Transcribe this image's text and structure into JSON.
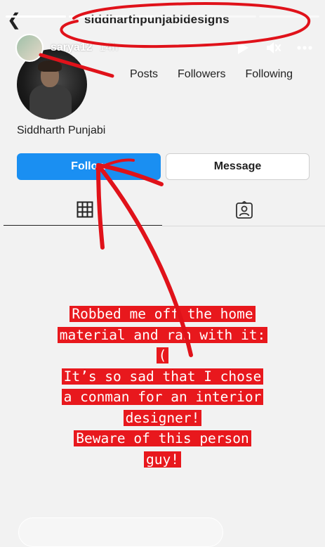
{
  "story": {
    "progress": [
      1,
      1,
      0.35,
      0,
      0
    ],
    "user": "sarya12",
    "time": "14h",
    "icons": {
      "play": "play-icon",
      "mute": "mute-icon",
      "more": "more-icon"
    }
  },
  "profile": {
    "back_icon": "back-arrow-icon",
    "username": "siddharthpunjabidesigns",
    "stats": {
      "posts": "Posts",
      "followers": "Followers",
      "following": "Following"
    },
    "display_name": "Siddharth Punjabi",
    "follow_label": "Follow",
    "message_label": "Message"
  },
  "tabs": {
    "grid_icon": "grid-icon",
    "tagged_icon": "tagged-icon"
  },
  "caption": {
    "lines": [
      "Robbed me off the home",
      "material and ran with it:",
      "(",
      "It’s so sad that I chose",
      "a conman for an interior",
      "designer!",
      "Beware of this person",
      "guy!"
    ]
  },
  "colors": {
    "follow_blue": "#1a8ff2",
    "caption_red": "#e8181d",
    "scribble_red": "#e0121a"
  }
}
